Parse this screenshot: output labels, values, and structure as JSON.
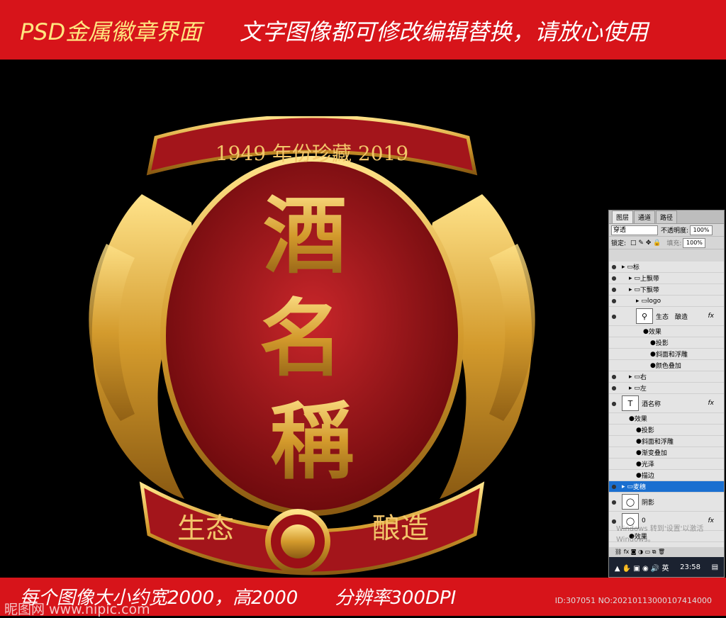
{
  "top_banner": {
    "left_text": "PSD金属徽章界面",
    "right_text": "文字图像都可修改编辑替换，请放心使用"
  },
  "badge": {
    "year_ribbon": "1949 年份珍藏 2019",
    "main_title_chars": [
      "酒",
      "名",
      "稱"
    ],
    "bottom_left": "生态",
    "bottom_right": "酿造"
  },
  "bottom_banner": {
    "text": "每个图像大小约宽2000，高2000　　分辨率300DPI",
    "watermark": "昵图网 www.nipic.com",
    "id_text": "ID:307051 NO:20210113000107414000"
  },
  "ps_panel": {
    "tabs": [
      "图层",
      "通道",
      "路径"
    ],
    "blend_mode": "穿透",
    "opacity_label": "不透明度:",
    "opacity_value": "100%",
    "lock_label": "锁定:",
    "fill_label": "填充:",
    "fill_value": "100%",
    "layers": [
      {
        "name": "标",
        "type": "group",
        "indent": 0
      },
      {
        "name": "上飘带",
        "type": "group",
        "indent": 1
      },
      {
        "name": "下飘带",
        "type": "group",
        "indent": 1
      },
      {
        "name": "logo",
        "type": "group",
        "indent": 2
      },
      {
        "name": "生态　酿造",
        "type": "smart",
        "indent": 2,
        "fx": "fx"
      },
      {
        "name": "效果",
        "type": "effect",
        "indent": 3
      },
      {
        "name": "投影",
        "type": "effect",
        "indent": 4
      },
      {
        "name": "斜面和浮雕",
        "type": "effect",
        "indent": 4
      },
      {
        "name": "颜色叠加",
        "type": "effect",
        "indent": 4
      },
      {
        "name": "右",
        "type": "group",
        "indent": 1
      },
      {
        "name": "左",
        "type": "group",
        "indent": 1
      },
      {
        "name": "酒名称",
        "type": "text",
        "indent": 0,
        "fx": "fx"
      },
      {
        "name": "效果",
        "type": "effect",
        "indent": 1
      },
      {
        "name": "投影",
        "type": "effect",
        "indent": 2
      },
      {
        "name": "斜面和浮雕",
        "type": "effect",
        "indent": 2
      },
      {
        "name": "渐变叠加",
        "type": "effect",
        "indent": 2
      },
      {
        "name": "光泽",
        "type": "effect",
        "indent": 2
      },
      {
        "name": "描边",
        "type": "effect",
        "indent": 2
      },
      {
        "name": "麦穗",
        "type": "group",
        "indent": 0,
        "selected": true
      },
      {
        "name": "阴影",
        "type": "image",
        "indent": 0
      },
      {
        "name": "0",
        "type": "image",
        "indent": 0,
        "fx": "fx"
      },
      {
        "name": "效果",
        "type": "effect",
        "indent": 1
      }
    ],
    "windows_watermark": "Windows 转到'设置'以激活 Windows。",
    "clock": "23:58"
  },
  "colors": {
    "banner_red": "#d7141a",
    "gold": "#d9a73a",
    "badge_red": "#9b1016"
  }
}
